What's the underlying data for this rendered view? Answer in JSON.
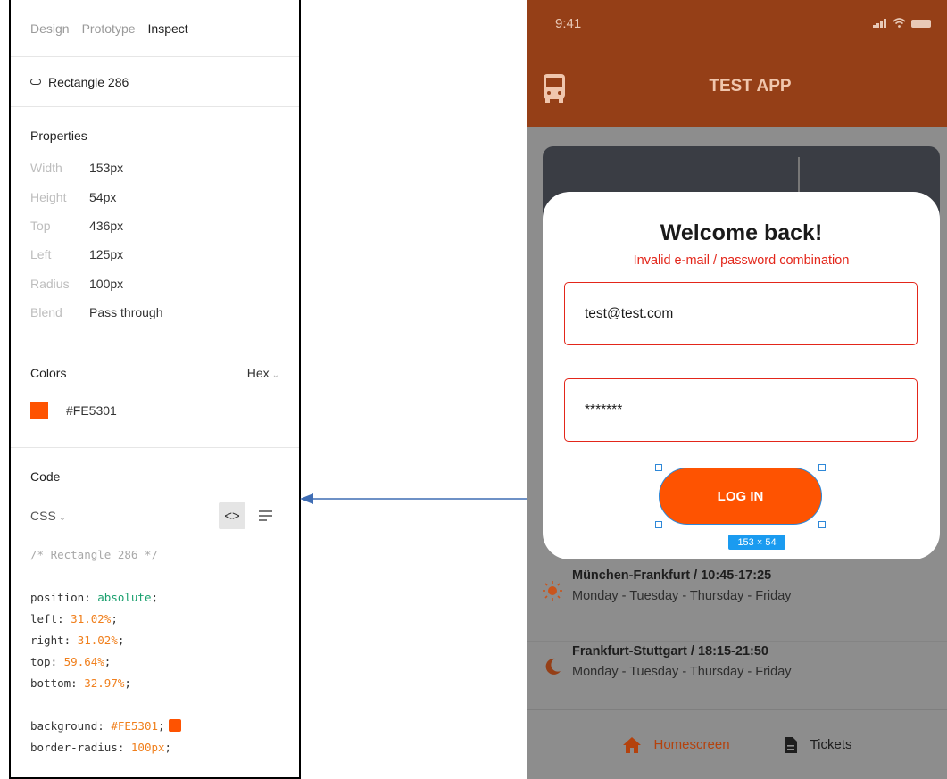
{
  "inspector": {
    "tabs": [
      "Design",
      "Prototype",
      "Inspect"
    ],
    "active_tab": "Inspect",
    "layer_name": "Rectangle 286",
    "properties": {
      "title": "Properties",
      "rows": [
        {
          "key": "Width",
          "value": "153px"
        },
        {
          "key": "Height",
          "value": "54px"
        },
        {
          "key": "Top",
          "value": "436px"
        },
        {
          "key": "Left",
          "value": "125px"
        },
        {
          "key": "Radius",
          "value": "100px"
        },
        {
          "key": "Blend",
          "value": "Pass through"
        }
      ]
    },
    "colors": {
      "title": "Colors",
      "format": "Hex",
      "value": "#FE5301",
      "swatch_color": "#FE5301"
    },
    "code": {
      "title": "Code",
      "language": "CSS",
      "comment": "/* Rectangle 286 */",
      "position_prop": "position:",
      "position_val": "absolute",
      "left_prop": "left:",
      "left_val": "31.02%",
      "right_prop": "right:",
      "right_val": "31.02%",
      "top_prop": "top:",
      "top_val": "59.64%",
      "bottom_prop": "bottom:",
      "bottom_val": "32.97%",
      "background_prop": "background:",
      "background_val": "#FE5301",
      "radius_prop": "border-radius:",
      "radius_val": "100px"
    }
  },
  "phone": {
    "status_time": "9:41",
    "app_title": "TEST APP",
    "accent_color": "#953F17",
    "routes": [
      {
        "title": "München-Frankfurt / 10:45-17:25",
        "days": "Monday - Tuesday - Thursday - Friday",
        "icon": "sun-icon"
      },
      {
        "title": "Frankfurt-Stuttgart / 18:15-21:50",
        "days": "Monday - Tuesday - Thursday - Friday",
        "icon": "moon-icon"
      }
    ],
    "nav": {
      "home_label": "Homescreen",
      "tickets_label": "Tickets"
    },
    "modal": {
      "title": "Welcome back!",
      "error": "Invalid e-mail / password combination",
      "email_value": "test@test.com",
      "password_value": "*******",
      "login_label": "LOG IN",
      "selection_size": "153 × 54"
    }
  }
}
